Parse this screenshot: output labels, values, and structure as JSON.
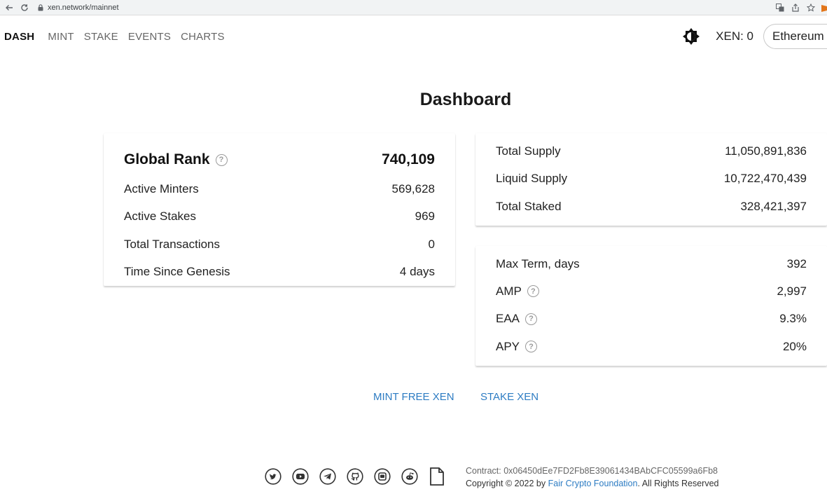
{
  "browser": {
    "url": "xen.network/mainnet"
  },
  "nav": {
    "items": [
      {
        "label": "DASH"
      },
      {
        "label": "MINT"
      },
      {
        "label": "STAKE"
      },
      {
        "label": "EVENTS"
      },
      {
        "label": "CHARTS"
      }
    ],
    "balance": "XEN: 0",
    "network": "Ethereum"
  },
  "page": {
    "title": "Dashboard"
  },
  "global": {
    "rank_label": "Global Rank",
    "rank_value": "740,109",
    "rows": [
      {
        "label": "Active Minters",
        "value": "569,628"
      },
      {
        "label": "Active Stakes",
        "value": "969"
      },
      {
        "label": "Total Transactions",
        "value": "0"
      },
      {
        "label": "Time Since Genesis",
        "value": "4 days"
      }
    ]
  },
  "supply": {
    "rows": [
      {
        "label": "Total Supply",
        "value": "11,050,891,836"
      },
      {
        "label": "Liquid Supply",
        "value": "10,722,470,439"
      },
      {
        "label": "Total Staked",
        "value": "328,421,397"
      }
    ]
  },
  "params": {
    "rows": [
      {
        "label": "Max Term, days",
        "value": "392"
      },
      {
        "label": "AMP",
        "value": "2,997"
      },
      {
        "label": "EAA",
        "value": "9.3%"
      },
      {
        "label": "APY",
        "value": "20%"
      }
    ]
  },
  "actions": {
    "mint": "MINT FREE XEN",
    "stake": "STAKE XEN"
  },
  "footer": {
    "contract_label": "Contract:",
    "contract_address": "0x06450dEe7FD2Fb8E39061434BAbCFC05599a6Fb8",
    "copyright_prefix": "Copyright © 2022 by",
    "org": "Fair Crypto Foundation",
    "copyright_suffix": ". All Rights Reserved"
  },
  "icons": [
    "back-arrow-icon",
    "reload-icon",
    "lock-icon",
    "translate-icon",
    "share-icon",
    "bookmark-star-icon",
    "metamask-icon",
    "theme-toggle-icon",
    "help-icon",
    "twitter-icon",
    "youtube-icon",
    "telegram-icon",
    "github-icon",
    "discord-icon",
    "reddit-icon",
    "document-icon"
  ],
  "colors": {
    "link": "#2d7cc3",
    "metamask": "#e2761b"
  }
}
